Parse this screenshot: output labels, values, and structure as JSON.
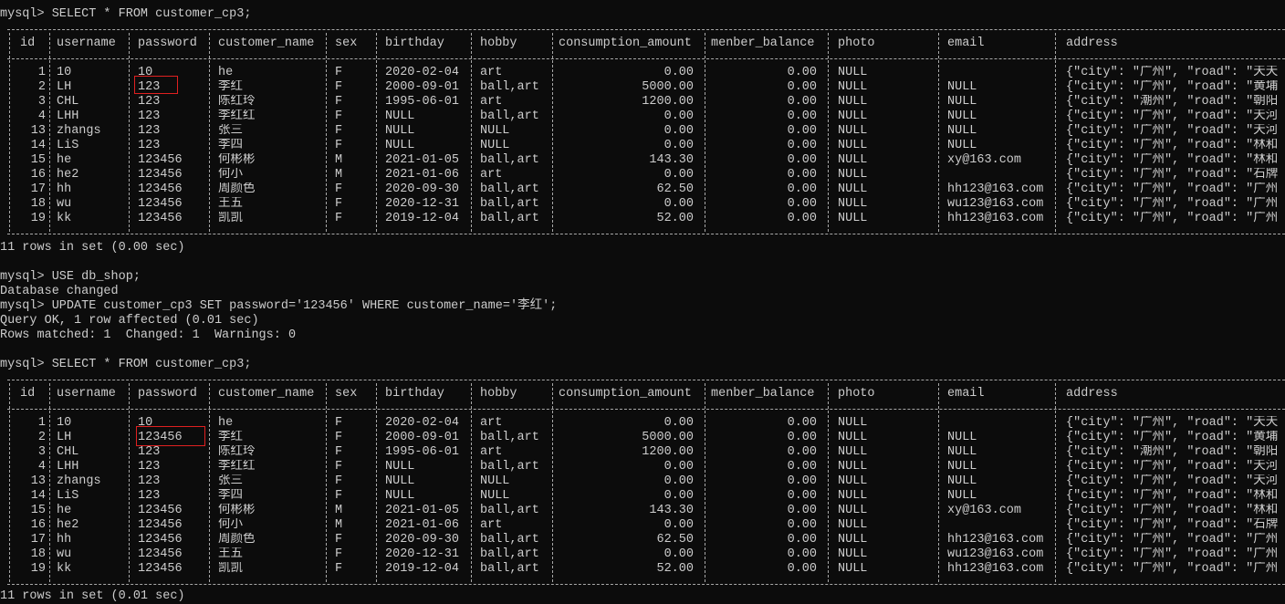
{
  "console": {
    "commands": {
      "select1": "mysql> SELECT * FROM customer_cp3;",
      "rows1": "11 rows in set (0.00 sec)",
      "use": "mysql> USE db_shop;",
      "db_changed": "Database changed",
      "update": "mysql> UPDATE customer_cp3 SET password='123456' WHERE customer_name='李红';",
      "query_ok": "Query OK, 1 row affected (0.01 sec)",
      "rows_matched": "Rows matched: 1  Changed: 1  Warnings: 0",
      "select2": "mysql> SELECT * FROM customer_cp3;",
      "rows2": "11 rows in set (0.01 sec)"
    }
  },
  "table": {
    "headers": [
      "id",
      "username",
      "password",
      "customer_name",
      "sex",
      "birthday",
      "hobby",
      "consumption_amount",
      "menber_balance",
      "photo",
      "email",
      "address"
    ]
  },
  "table1": {
    "rows": [
      [
        "1",
        "10",
        "10",
        "he",
        "F",
        "2020-02-04",
        "art",
        "0.00",
        "0.00",
        "NULL",
        "",
        "{\"city\": \"广州\", \"road\": \"天天"
      ],
      [
        "2",
        "LH",
        "123",
        "李红",
        "F",
        "2000-09-01",
        "ball,art",
        "5000.00",
        "0.00",
        "NULL",
        "NULL",
        "{\"city\": \"广州\", \"road\": \"黄埔"
      ],
      [
        "3",
        "CHL",
        "123",
        "陈红玲",
        "F",
        "1995-06-01",
        "art",
        "1200.00",
        "0.00",
        "NULL",
        "NULL",
        "{\"city\": \"潮州\", \"road\": \"朝阳"
      ],
      [
        "4",
        "LHH",
        "123",
        "李红红",
        "F",
        "NULL",
        "ball,art",
        "0.00",
        "0.00",
        "NULL",
        "NULL",
        "{\"city\": \"广州\", \"road\": \"天河"
      ],
      [
        "13",
        "zhangs",
        "123",
        "张三",
        "F",
        "NULL",
        "NULL",
        "0.00",
        "0.00",
        "NULL",
        "NULL",
        "{\"city\": \"广州\", \"road\": \"天河"
      ],
      [
        "14",
        "LiS",
        "123",
        "李四",
        "F",
        "NULL",
        "NULL",
        "0.00",
        "0.00",
        "NULL",
        "NULL",
        "{\"city\": \"广州\", \"road\": \"林和"
      ],
      [
        "15",
        "he",
        "123456",
        "何彬彬",
        "M",
        "2021-01-05",
        "ball,art",
        "143.30",
        "0.00",
        "NULL",
        "xy@163.com",
        "{\"city\": \"广州\", \"road\": \"林和"
      ],
      [
        "16",
        "he2",
        "123456",
        "何小",
        "M",
        "2021-01-06",
        "art",
        "0.00",
        "0.00",
        "NULL",
        "",
        "{\"city\": \"广州\", \"road\": \"石牌"
      ],
      [
        "17",
        "hh",
        "123456",
        "周颜色",
        "F",
        "2020-09-30",
        "ball,art",
        "62.50",
        "0.00",
        "NULL",
        "hh123@163.com",
        "{\"city\": \"广州\", \"road\": \"广州"
      ],
      [
        "18",
        "wu",
        "123456",
        "王五",
        "F",
        "2020-12-31",
        "ball,art",
        "0.00",
        "0.00",
        "NULL",
        "wu123@163.com",
        "{\"city\": \"广州\", \"road\": \"广州"
      ],
      [
        "19",
        "kk",
        "123456",
        "凯凯",
        "F",
        "2019-12-04",
        "ball,art",
        "52.00",
        "0.00",
        "NULL",
        "hh123@163.com",
        "{\"city\": \"广州\", \"road\": \"广州"
      ]
    ]
  },
  "table2": {
    "rows": [
      [
        "1",
        "10",
        "10",
        "he",
        "F",
        "2020-02-04",
        "art",
        "0.00",
        "0.00",
        "NULL",
        "",
        "{\"city\": \"广州\", \"road\": \"天天"
      ],
      [
        "2",
        "LH",
        "123456",
        "李红",
        "F",
        "2000-09-01",
        "ball,art",
        "5000.00",
        "0.00",
        "NULL",
        "NULL",
        "{\"city\": \"广州\", \"road\": \"黄埔"
      ],
      [
        "3",
        "CHL",
        "123",
        "陈红玲",
        "F",
        "1995-06-01",
        "art",
        "1200.00",
        "0.00",
        "NULL",
        "NULL",
        "{\"city\": \"潮州\", \"road\": \"朝阳"
      ],
      [
        "4",
        "LHH",
        "123",
        "李红红",
        "F",
        "NULL",
        "ball,art",
        "0.00",
        "0.00",
        "NULL",
        "NULL",
        "{\"city\": \"广州\", \"road\": \"天河"
      ],
      [
        "13",
        "zhangs",
        "123",
        "张三",
        "F",
        "NULL",
        "NULL",
        "0.00",
        "0.00",
        "NULL",
        "NULL",
        "{\"city\": \"广州\", \"road\": \"天河"
      ],
      [
        "14",
        "LiS",
        "123",
        "李四",
        "F",
        "NULL",
        "NULL",
        "0.00",
        "0.00",
        "NULL",
        "NULL",
        "{\"city\": \"广州\", \"road\": \"林和"
      ],
      [
        "15",
        "he",
        "123456",
        "何彬彬",
        "M",
        "2021-01-05",
        "ball,art",
        "143.30",
        "0.00",
        "NULL",
        "xy@163.com",
        "{\"city\": \"广州\", \"road\": \"林和"
      ],
      [
        "16",
        "he2",
        "123456",
        "何小",
        "M",
        "2021-01-06",
        "art",
        "0.00",
        "0.00",
        "NULL",
        "",
        "{\"city\": \"广州\", \"road\": \"石牌"
      ],
      [
        "17",
        "hh",
        "123456",
        "周颜色",
        "F",
        "2020-09-30",
        "ball,art",
        "62.50",
        "0.00",
        "NULL",
        "hh123@163.com",
        "{\"city\": \"广州\", \"road\": \"广州"
      ],
      [
        "18",
        "wu",
        "123456",
        "王五",
        "F",
        "2020-12-31",
        "ball,art",
        "0.00",
        "0.00",
        "NULL",
        "wu123@163.com",
        "{\"city\": \"广州\", \"road\": \"广州"
      ],
      [
        "19",
        "kk",
        "123456",
        "凯凯",
        "F",
        "2019-12-04",
        "ball,art",
        "52.00",
        "0.00",
        "NULL",
        "hh123@163.com",
        "{\"city\": \"广州\", \"road\": \"广州"
      ]
    ]
  },
  "highlight_color": "#e02020"
}
